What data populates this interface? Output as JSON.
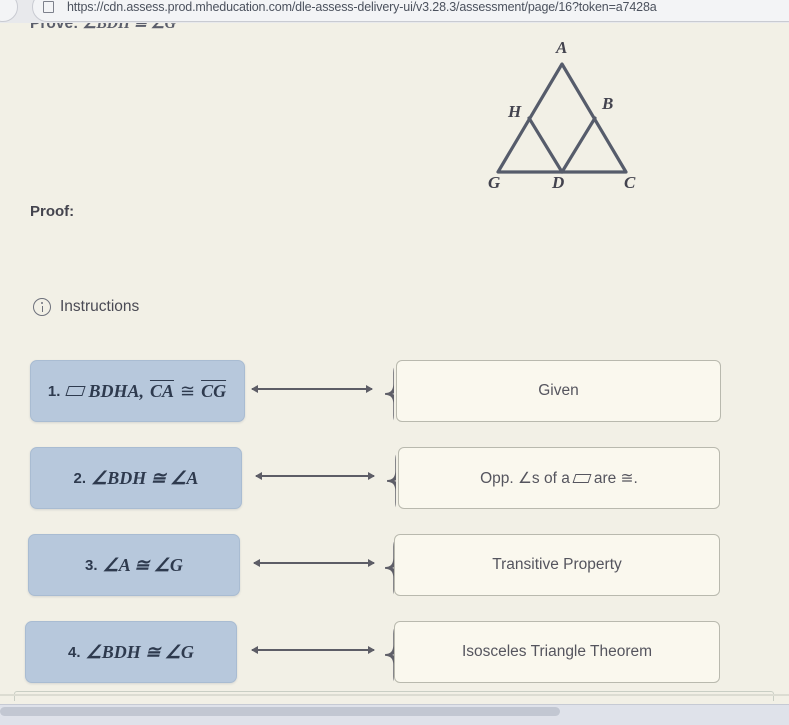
{
  "browser": {
    "url": "https://cdn.assess.prod.mheducation.com/dle-assess-delivery-ui/v3.28.3/assessment/page/16?token=a7428a",
    "page_icon": "page-icon"
  },
  "problem": {
    "prove_label": "Prove:",
    "prove_statement": "∠BDH ≅ ∠G",
    "proof_heading": "Proof:"
  },
  "figure": {
    "name": "triangle-diagram",
    "vertices": [
      "A",
      "B",
      "C",
      "D",
      "G",
      "H"
    ],
    "labels": {
      "A": "A",
      "B": "B",
      "C": "C",
      "D": "D",
      "G": "G",
      "H": "H"
    }
  },
  "instructions": {
    "icon": "info-icon",
    "label": "Instructions"
  },
  "rows": [
    {
      "number": "1.",
      "statement_prefix": "",
      "statement_tail_a": "BDHA,",
      "statement_over_1": "CA",
      "statement_mid": "≅",
      "statement_over_2": "CG",
      "reason": "Given",
      "reason_has_pgram": false
    },
    {
      "number": "2.",
      "statement": "∠BDH ≅ ∠A",
      "reason_pre": "Opp. ∠s of a",
      "reason_post": "are ≅.",
      "reason_has_pgram": true
    },
    {
      "number": "3.",
      "statement": "∠A ≅ ∠G",
      "reason": "Transitive Property",
      "reason_has_pgram": false
    },
    {
      "number": "4.",
      "statement": "∠BDH ≅ ∠G",
      "reason": "Isosceles Triangle Theorem",
      "reason_has_pgram": false
    }
  ],
  "colors": {
    "statement_box": "#b7c8dc",
    "reason_box": "#faf8ee",
    "page_background": "#f2f0e6",
    "ink": "#3a3a44"
  }
}
